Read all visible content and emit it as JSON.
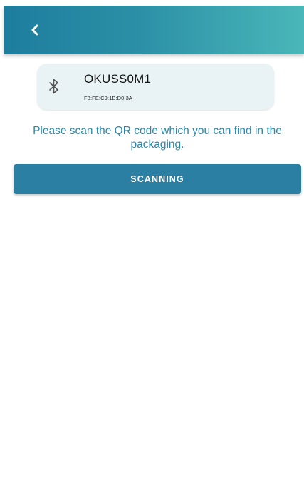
{
  "app_bar": {
    "back_icon": "chevron-left-icon",
    "gradient_start": "#1e7d9e",
    "gradient_end": "#4ab7b9"
  },
  "device": {
    "icon": "bluetooth-icon",
    "name": "OKUSS0M1",
    "address": "F8:FE:C9:1B:D0:3A",
    "card_color": "#e9f3f5"
  },
  "instruction": {
    "text": "Please scan the QR code which you can find in the packaging.",
    "color": "#2a87a9"
  },
  "scan_button": {
    "label": "SCANNING",
    "color": "#2a7fa3"
  }
}
